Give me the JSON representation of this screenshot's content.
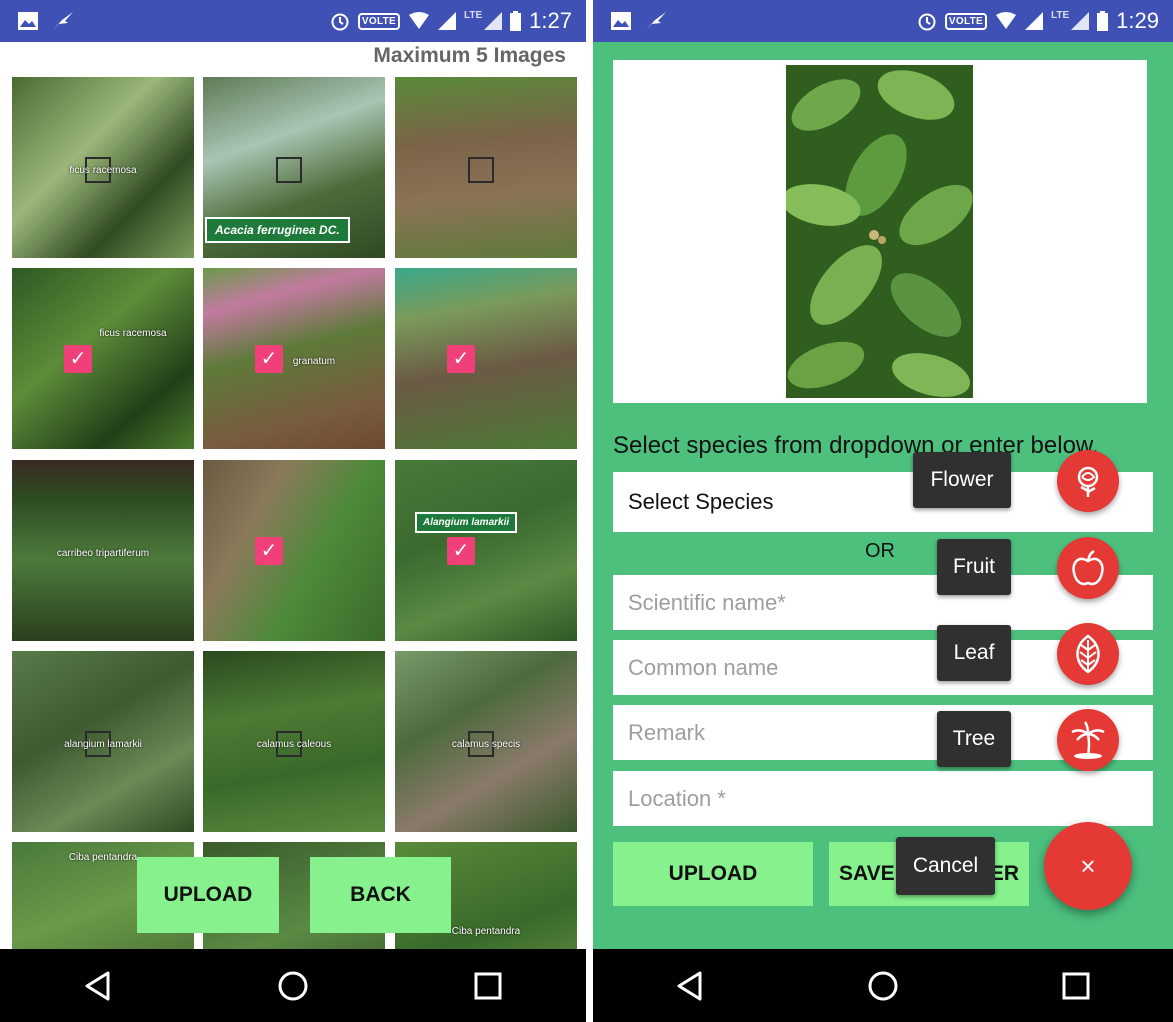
{
  "left": {
    "status": {
      "time": "1:27",
      "volte": "VOLTE",
      "network": "LTE"
    },
    "max_label": "Maximum 5 Images",
    "tiles": [
      {
        "label": "ficus racemosa"
      },
      {
        "label": "",
        "sign": "Acacia ferruginea DC."
      },
      {
        "label": ""
      },
      {
        "label": "ficus racemosa"
      },
      {
        "label": "granatum"
      },
      {
        "label": ""
      },
      {
        "label": "carribeo tripartiferum"
      },
      {
        "label": ""
      },
      {
        "label": "",
        "sign": "Alangium lamarkii"
      },
      {
        "label": "alangium lamarkii"
      },
      {
        "label": "calamus caleous"
      },
      {
        "label": "calamus specis"
      },
      {
        "label": "Ciba pentandra"
      },
      {
        "label": ""
      },
      {
        "label": "Ciba pentandra"
      }
    ],
    "buttons": {
      "upload": "UPLOAD",
      "back": "BACK"
    }
  },
  "right": {
    "status": {
      "time": "1:29",
      "volte": "VOLTE",
      "network": "LTE"
    },
    "instruction": "Select species from dropdown or enter below.",
    "select_species": "Select Species",
    "or_label": "OR",
    "scientific_placeholder": "Scientific name*",
    "common_placeholder": "Common name",
    "remark_placeholder": "Remark",
    "location_placeholder": "Location *",
    "upload_label": "UPLOAD",
    "save_label": "SAVE FOR LATER",
    "fab_menu": {
      "flower": "Flower",
      "fruit": "Fruit",
      "leaf": "Leaf",
      "tree": "Tree",
      "cancel": "Cancel",
      "close_symbol": "×"
    }
  },
  "colors": {
    "status_bar": "#3f51b5",
    "green_bg": "#4dc07e",
    "button_green": "#86f18d",
    "fab_red": "#e53935",
    "check_pink": "#f0407a"
  }
}
